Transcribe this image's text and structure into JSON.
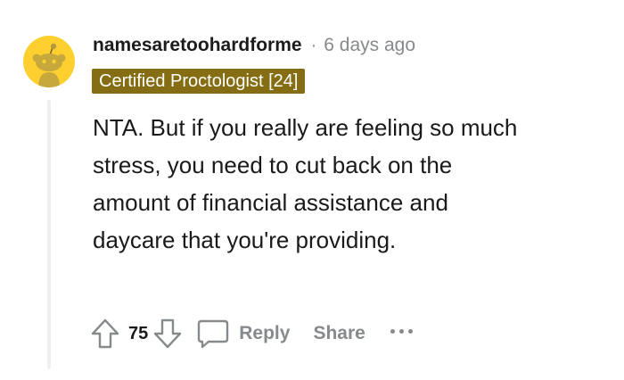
{
  "comment": {
    "username": "namesaretoohardforme",
    "separator": "·",
    "timestamp": "6 days ago",
    "flair": "Certified Proctologist [24]",
    "body": "NTA. But if you really are feeling so much stress, you need to cut back on the amount of financial assistance and daycare that you're providing.",
    "score": "75",
    "reply_label": "Reply",
    "share_label": "Share",
    "avatar_color": "#fed02f",
    "flair_color": "#846d12",
    "muted_color": "#878a8c"
  }
}
